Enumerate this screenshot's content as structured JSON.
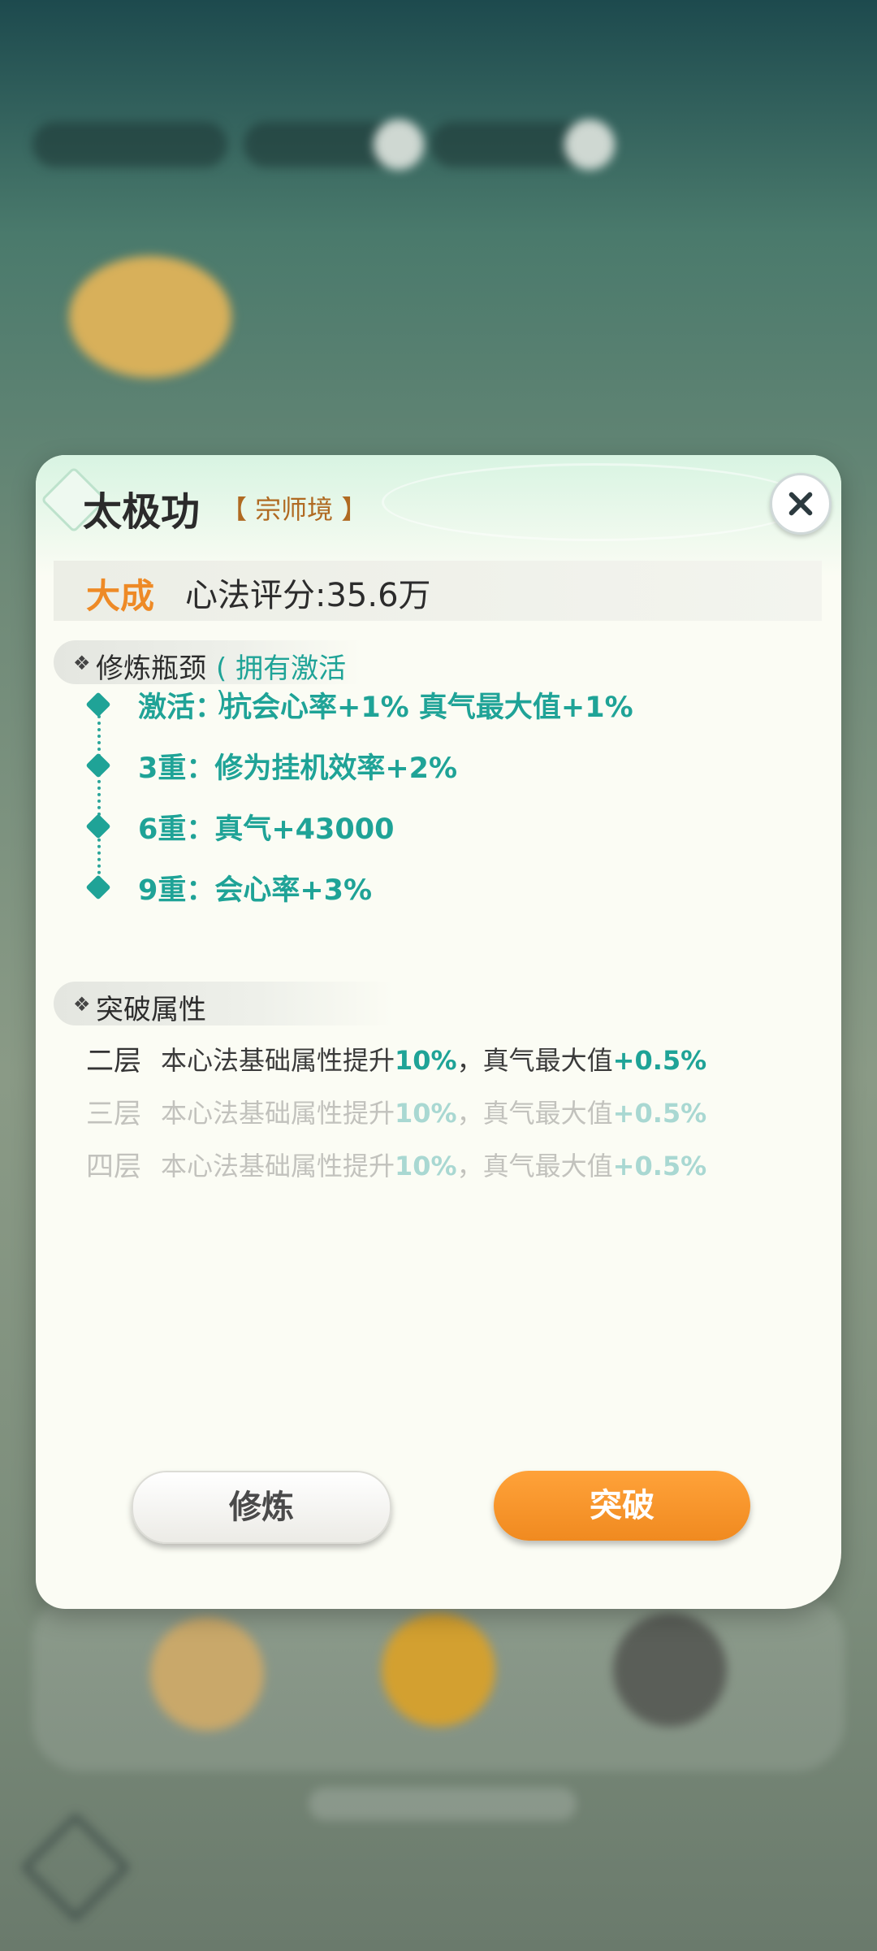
{
  "modal": {
    "title": "太极功",
    "rank": "【 宗师境 】",
    "level": "大成",
    "score_text": "心法评分:35.6万",
    "bottleneck": {
      "header": "修炼瓶颈",
      "status": "( 拥有激活 )",
      "items": [
        {
          "label": "激活：抗会心率+1%  真气最大值+1%"
        },
        {
          "label": "3重：修为挂机效率+2%"
        },
        {
          "label": "6重：真气+43000"
        },
        {
          "label": "9重：会心率+3%"
        }
      ]
    },
    "breakthrough": {
      "header": "突破属性",
      "rows": [
        {
          "tier": "二层",
          "desc_a": "本心法基础属性提升",
          "num_a": "10%",
          "desc_b": "，真气最大值",
          "num_b": "+0.5%",
          "active": true
        },
        {
          "tier": "三层",
          "desc_a": "本心法基础属性提升",
          "num_a": "10%",
          "desc_b": "，真气最大值",
          "num_b": "+0.5%",
          "active": false
        },
        {
          "tier": "四层",
          "desc_a": "本心法基础属性提升",
          "num_a": "10%",
          "desc_b": "，真气最大值",
          "num_b": "+0.5%",
          "active": false
        }
      ]
    },
    "buttons": {
      "cultivate": "修炼",
      "breakthrough": "突破"
    }
  },
  "icons": {
    "close": "close-icon",
    "section_marker": "diamond-icon",
    "title_marker": "diamond-frame-icon"
  },
  "colors": {
    "accent_teal": "#1fa397",
    "accent_orange": "#ee8a26",
    "button_orange": "#f08a20"
  }
}
